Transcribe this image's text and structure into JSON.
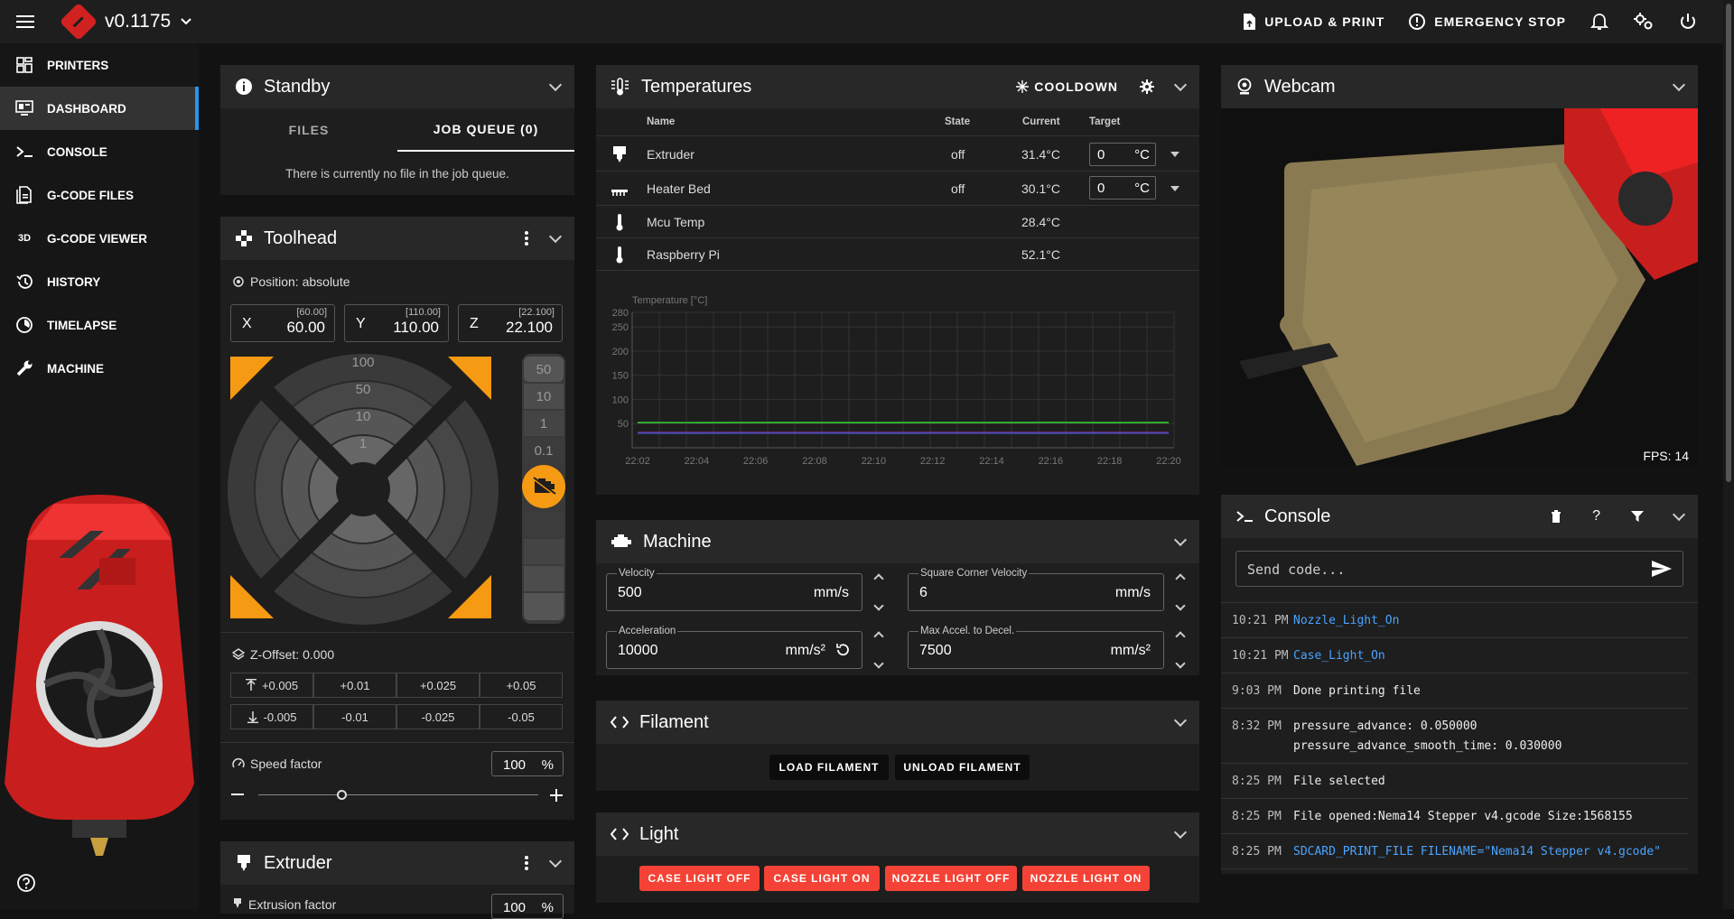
{
  "app": {
    "version": "v0.1175"
  },
  "topbar": {
    "upload_print": "UPLOAD & PRINT",
    "emergency_stop": "EMERGENCY STOP"
  },
  "sidebar": {
    "items": [
      {
        "label": "PRINTERS",
        "icon": "grid-icon"
      },
      {
        "label": "DASHBOARD",
        "icon": "monitor-icon",
        "active": true
      },
      {
        "label": "CONSOLE",
        "icon": "console-icon"
      },
      {
        "label": "G-CODE FILES",
        "icon": "file-icon"
      },
      {
        "label": "G-CODE VIEWER",
        "icon": "3d-icon"
      },
      {
        "label": "HISTORY",
        "icon": "history-icon"
      },
      {
        "label": "TIMELAPSE",
        "icon": "timelapse-icon"
      },
      {
        "label": "MACHINE",
        "icon": "wrench-icon"
      }
    ]
  },
  "status": {
    "title": "Standby",
    "tabs": [
      "FILES",
      "JOB QUEUE (0)"
    ],
    "empty_text": "There is currently no file in the job queue."
  },
  "toolhead": {
    "title": "Toolhead",
    "position_label": "Position: absolute",
    "axes": [
      {
        "axis": "X",
        "limit": "[60.00]",
        "value": "60.00"
      },
      {
        "axis": "Y",
        "limit": "[110.00]",
        "value": "110.00"
      },
      {
        "axis": "Z",
        "limit": "[22.100]",
        "value": "22.100"
      }
    ],
    "xy_steps": [
      "100",
      "50",
      "10",
      "1"
    ],
    "z_steps": [
      "50",
      "10",
      "1",
      "0.1"
    ],
    "zoffset_label": "Z-Offset: 0.000",
    "zoffset_up": [
      "+0.005",
      "+0.01",
      "+0.025",
      "+0.05"
    ],
    "zoffset_down": [
      "-0.005",
      "-0.01",
      "-0.025",
      "-0.05"
    ],
    "speed_label": "Speed factor",
    "speed_value": "100",
    "speed_unit": "%",
    "speed_fraction": 0.3
  },
  "extruder": {
    "title": "Extruder",
    "factor_label": "Extrusion factor",
    "factor_value": "100",
    "factor_unit": "%"
  },
  "temperatures": {
    "title": "Temperatures",
    "cooldown": "COOLDOWN",
    "headers": {
      "name": "Name",
      "state": "State",
      "current": "Current",
      "target": "Target"
    },
    "rows": [
      {
        "name": "Extruder",
        "state": "off",
        "current": "31.4°C",
        "target": "0",
        "unit": "°C"
      },
      {
        "name": "Heater Bed",
        "state": "off",
        "current": "30.1°C",
        "target": "0",
        "unit": "°C"
      },
      {
        "name": "Mcu Temp",
        "state": "",
        "current": "28.4°C"
      },
      {
        "name": "Raspberry Pi",
        "state": "",
        "current": "52.1°C"
      }
    ]
  },
  "chart_data": {
    "type": "line",
    "ylabel": "Temperature [°C]",
    "ylim": [
      0,
      280
    ],
    "yticks": [
      50,
      100,
      150,
      200,
      250,
      280
    ],
    "categories": [
      "22:02",
      "22:04",
      "22:06",
      "22:08",
      "22:10",
      "22:12",
      "22:14",
      "22:16",
      "22:18",
      "22:20"
    ],
    "series": [
      {
        "values": [
          52.1,
          52.0,
          52.2,
          52.1,
          52.0,
          52.2,
          52.1,
          52.3,
          52.0,
          52.1
        ],
        "color": "#33cc33"
      },
      {
        "values": [
          31.4,
          31.4,
          31.3,
          31.4,
          31.4,
          31.3,
          31.4,
          31.4,
          31.3,
          31.4
        ],
        "color": "#9c27b0"
      },
      {
        "values": [
          30.1,
          30.0,
          30.1,
          30.1,
          30.0,
          30.1,
          30.1,
          30.0,
          30.1,
          30.1
        ],
        "color": "#3f51b5"
      }
    ]
  },
  "machine": {
    "title": "Machine",
    "velocity": {
      "label": "Velocity",
      "value": "500",
      "unit": "mm/s"
    },
    "scv": {
      "label": "Square Corner Velocity",
      "value": "6",
      "unit": "mm/s"
    },
    "accel": {
      "label": "Acceleration",
      "value": "10000",
      "unit": "mm/s²"
    },
    "accel_decel": {
      "label": "Max Accel. to Decel.",
      "value": "7500",
      "unit": "mm/s²"
    }
  },
  "filament": {
    "title": "Filament",
    "load": "LOAD FILAMENT",
    "unload": "UNLOAD FILAMENT"
  },
  "light": {
    "title": "Light",
    "buttons": [
      "CASE LIGHT OFF",
      "CASE LIGHT ON",
      "NOZZLE LIGHT OFF",
      "NOZZLE LIGHT ON"
    ]
  },
  "webcam": {
    "title": "Webcam",
    "fps": "FPS: 14"
  },
  "console": {
    "title": "Console",
    "placeholder": "Send code...",
    "lines": [
      {
        "time": "10:21 PM",
        "text": "Nozzle_Light_On",
        "cmd": true
      },
      {
        "time": "10:21 PM",
        "text": "Case_Light_On",
        "cmd": true
      },
      {
        "time": "9:03 PM",
        "text": "Done printing file",
        "cmd": false
      },
      {
        "time": "8:32 PM",
        "text": "pressure_advance: 0.050000",
        "text2": "pressure_advance_smooth_time: 0.030000",
        "cmd": false
      },
      {
        "time": "8:25 PM",
        "text": "File selected",
        "cmd": false
      },
      {
        "time": "8:25 PM",
        "text": "File opened:Nema14 Stepper v4.gcode Size:1568155",
        "cmd": false
      },
      {
        "time": "8:25 PM",
        "text": "SDCARD_PRINT_FILE FILENAME=\"Nema14 Stepper v4.gcode\"",
        "cmd": true
      }
    ]
  },
  "colors": {
    "accent": "#2196f3",
    "orange": "#f59a12",
    "red": "#f44336",
    "green": "#33cc33",
    "purple": "#9c27b0"
  }
}
